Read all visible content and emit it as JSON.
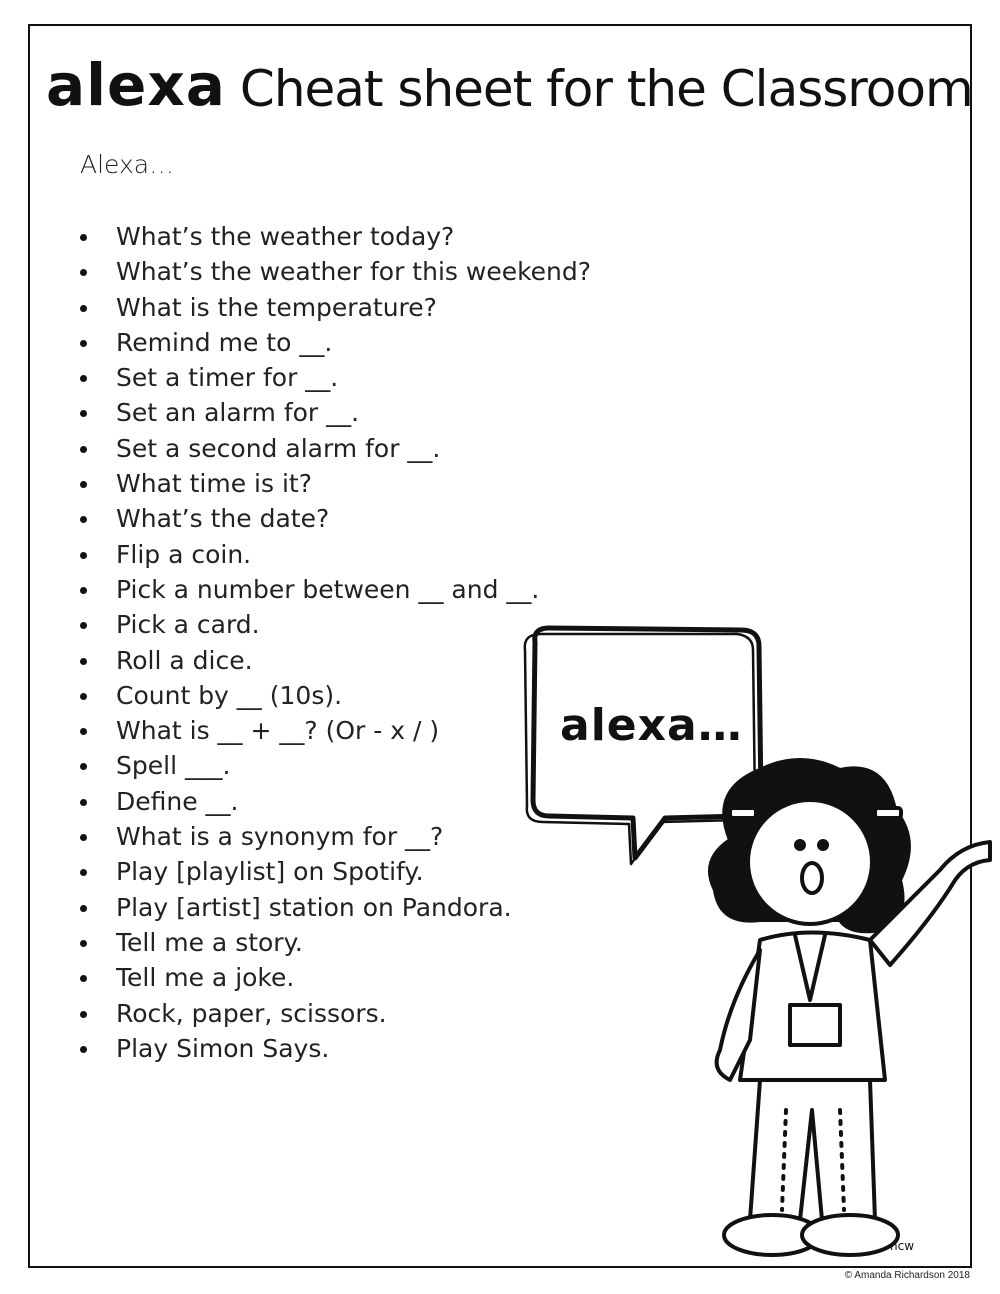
{
  "title": {
    "bold": "alexa",
    "rest": "Cheat sheet for the Classroom"
  },
  "intro": "Alexa…",
  "commands": [
    "What’s the weather today?",
    "What’s the weather for this weekend?",
    "What is the temperature?",
    "Remind me to __.",
    "Set a timer for __.",
    "Set an alarm for __.",
    "Set a second alarm for __.",
    "What time is it?",
    "What’s the date?",
    "Flip a coin.",
    "Pick a number between __ and __.",
    "Pick a card.",
    "Roll a dice.",
    "Count by __ (10s).",
    "What is __ + __?  (Or - x / )",
    "Spell ___.",
    "Define __.",
    "What is a synonym for __?",
    "Play [playlist] on Spotify.",
    "Play [artist] station on Pandora.",
    "Tell me a story.",
    "Tell me a joke.",
    "Rock, paper, scissors.",
    "Play Simon Says."
  ],
  "bubble": {
    "text": "alexa…"
  },
  "illustration": {
    "icon": "girl-pointing-illustration",
    "signature": "ncw"
  },
  "copyright": "© Amanda Richardson 2018"
}
